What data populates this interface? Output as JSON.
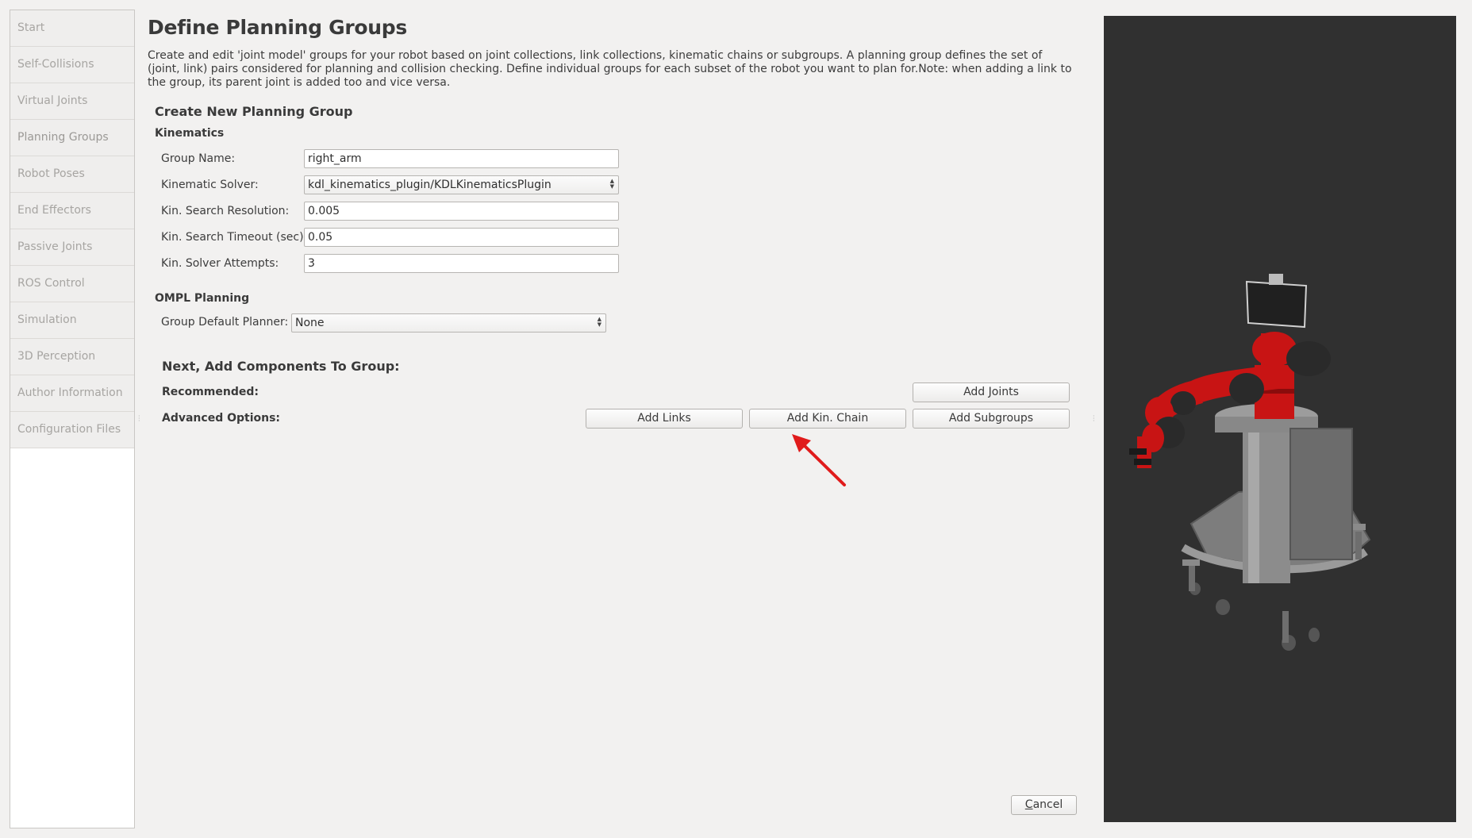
{
  "sidebar": {
    "items": [
      {
        "label": "Start"
      },
      {
        "label": "Self-Collisions"
      },
      {
        "label": "Virtual Joints"
      },
      {
        "label": "Planning Groups"
      },
      {
        "label": "Robot Poses"
      },
      {
        "label": "End Effectors"
      },
      {
        "label": "Passive Joints"
      },
      {
        "label": "ROS Control"
      },
      {
        "label": "Simulation"
      },
      {
        "label": "3D Perception"
      },
      {
        "label": "Author Information"
      },
      {
        "label": "Configuration Files"
      }
    ]
  },
  "page": {
    "title": "Define Planning Groups",
    "description": "Create and edit 'joint model' groups for your robot based on joint collections, link collections, kinematic chains or subgroups. A planning group defines the set of (joint, link) pairs considered for planning and collision checking. Define individual groups for each subset of the robot you want to plan for.Note: when adding a link to the group, its parent joint is added too and vice versa."
  },
  "form": {
    "section_title": "Create New Planning Group",
    "kinematics_title": "Kinematics",
    "group_name": {
      "label": "Group Name:",
      "value": "right_arm"
    },
    "solver": {
      "label": "Kinematic Solver:",
      "value": "kdl_kinematics_plugin/KDLKinematicsPlugin"
    },
    "resolution": {
      "label": "Kin. Search Resolution:",
      "value": "0.005"
    },
    "timeout": {
      "label": "Kin. Search Timeout (sec):",
      "value": "0.05"
    },
    "attempts": {
      "label": "Kin. Solver Attempts:",
      "value": "3"
    },
    "ompl_title": "OMPL Planning",
    "planner": {
      "label": "Group Default Planner:",
      "value": "None"
    }
  },
  "components": {
    "title": "Next, Add Components To Group:",
    "recommended_label": "Recommended:",
    "advanced_label": "Advanced Options:",
    "add_joints": "Add Joints",
    "add_links": "Add Links",
    "add_kin_chain": "Add Kin. Chain",
    "add_subgroups": "Add Subgroups"
  },
  "footer": {
    "cancel_mnemonic": "C",
    "cancel_rest": "ancel"
  },
  "colors": {
    "robot_red": "#c81414",
    "robot_dark": "#2a2a2a",
    "robot_gray": "#8e8e8e",
    "viewport_bg": "#303030",
    "annotation_arrow": "#e01b1b"
  }
}
